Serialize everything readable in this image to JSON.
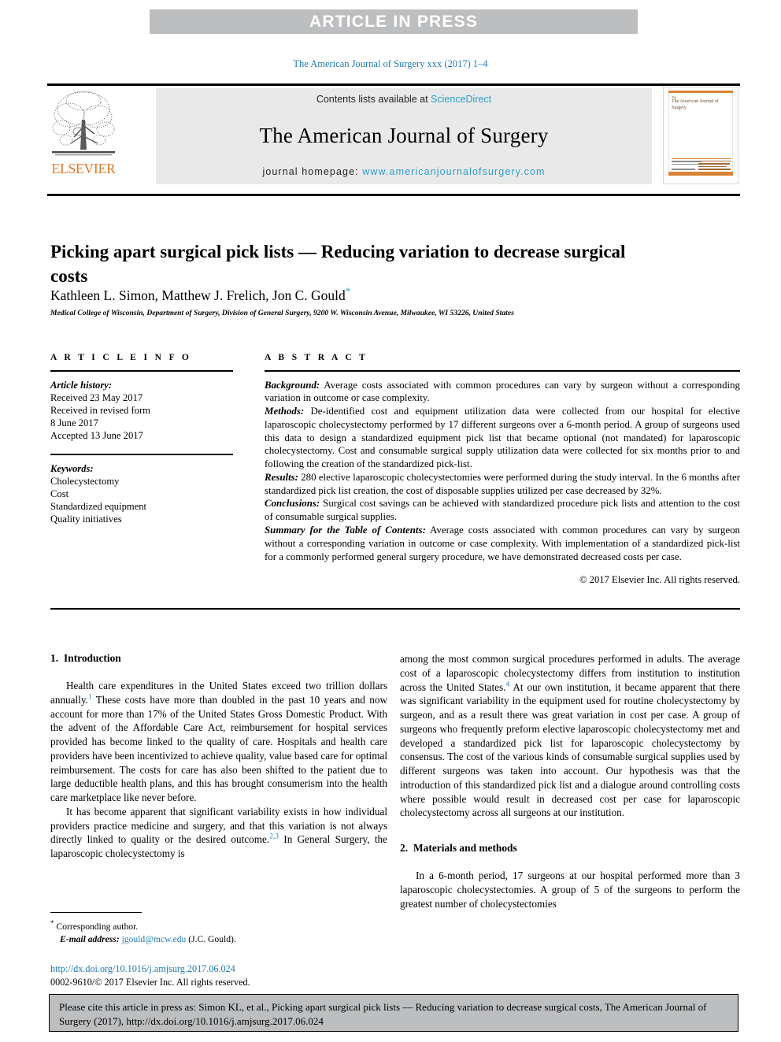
{
  "banner": {
    "text": "ARTICLE IN PRESS"
  },
  "running_head": {
    "text": "The American Journal of Surgery xxx (2017) 1–4"
  },
  "masthead": {
    "publisher_name": "ELSEVIER",
    "contents_prefix": "Contents lists available at ",
    "contents_link": "ScienceDirect",
    "journal_title": "The American Journal of Surgery",
    "homepage_label": "journal homepage: ",
    "homepage_url": "www.americanjournalofsurgery.com",
    "cover_title": "The American Journal of Surgery",
    "accent_orange": "#E87722",
    "link_blue": "#2b9ccc"
  },
  "article": {
    "title": "Picking apart surgical pick lists — Reducing variation to decrease surgical costs",
    "authors": "Kathleen L. Simon, Matthew J. Frelich, Jon C. Gould",
    "corresponding_marker": "*",
    "affiliation": "Medical College of Wisconsin, Department of Surgery, Division of General Surgery, 9200 W. Wisconsin Avenue, Milwaukee, WI 53226, United States"
  },
  "article_info": {
    "heading": "A R T I C L E  I N F O",
    "history_label": "Article history:",
    "history_lines": [
      "Received 23 May 2017",
      "Received in revised form",
      "8 June 2017",
      "Accepted 13 June 2017"
    ],
    "keywords_label": "Keywords:",
    "keywords": [
      "Cholecystectomy",
      "Cost",
      "Standardized equipment",
      "Quality initiatives"
    ]
  },
  "abstract": {
    "heading": "A B S T R A C T",
    "sections": [
      {
        "label": "Background:",
        "text": " Average costs associated with common procedures can vary by surgeon without a corresponding variation in outcome or case complexity."
      },
      {
        "label": "Methods:",
        "text": " De-identified cost and equipment utilization data were collected from our hospital for elective laparoscopic cholecystectomy performed by 17 different surgeons over a 6-month period. A group of surgeons used this data to design a standardized equipment pick list that became optional (not mandated) for laparoscopic cholecystectomy. Cost and consumable surgical supply utilization data were collected for six months prior to and following the creation of the standardized pick-list."
      },
      {
        "label": "Results:",
        "text": " 280 elective laparoscopic cholecystectomies were performed during the study interval. In the 6 months after standardized pick list creation, the cost of disposable supplies utilized per case decreased by 32%."
      },
      {
        "label": "Conclusions:",
        "text": " Surgical cost savings can be achieved with standardized procedure pick lists and attention to the cost of consumable surgical supplies."
      },
      {
        "label": "Summary for the Table of Contents:",
        "text": " Average costs associated with common procedures can vary by surgeon without a corresponding variation in outcome or case complexity. With implementation of a standardized pick-list for a commonly performed general surgery procedure, we have demonstrated decreased costs per case."
      }
    ],
    "copyright": "© 2017 Elsevier Inc. All rights reserved."
  },
  "body": {
    "left_column": {
      "section_number": "1.",
      "section_title": "Introduction",
      "paragraph_1_a": "Health care expenditures in the United States exceed two trillion dollars annually.",
      "paragraph_1_ref": "1",
      "paragraph_1_b": " These costs have more than doubled in the past 10 years and now account for more than 17% of the United States Gross Domestic Product. With the advent of the Affordable Care Act, reimbursement for hospital services provided has become linked to the quality of care. Hospitals and health care providers have been incentivized to achieve quality, value based care for optimal reimbursement. The costs for care has also been shifted to the patient due to large deductible health plans, and this has brought consumerism into the health care marketplace like never before.",
      "paragraph_2_a": "It has become apparent that significant variability exists in how individual providers practice medicine and surgery, and that this variation is not always directly linked to quality or the desired outcome.",
      "paragraph_2_ref": "2,3",
      "paragraph_2_b": " In General Surgery, the laparoscopic cholecystectomy is"
    },
    "right_column": {
      "paragraph_1_a": "among the most common surgical procedures performed in adults. The average cost of a laparoscopic cholecystectomy differs from institution to institution across the United States.",
      "paragraph_1_ref": "4",
      "paragraph_1_b": " At our own institution, it became apparent that there was significant variability in the equipment used for routine cholecystectomy by surgeon, and as a result there was great variation in cost per case. A group of surgeons who frequently preform elective laparoscopic cholecystectomy met and developed a standardized pick list for laparoscopic cholecystectomy by consensus. The cost of the various kinds of consumable surgical supplies used by different surgeons was taken into account. Our hypothesis was that the introduction of this standardized pick list and a dialogue around controlling costs where possible would result in decreased cost per case for laparoscopic cholecystectomy across all surgeons at our institution.",
      "section_number": "2.",
      "section_title": "Materials and methods",
      "paragraph_2": "In a 6-month period, 17 surgeons at our hospital performed more than 3 laparoscopic cholecystectomies. A group of 5 of the surgeons to perform the greatest number of cholecystectomies"
    }
  },
  "footnote": {
    "star": "*",
    "corresponding": "Corresponding author.",
    "email_label": "E-mail address:",
    "email": "jgould@mcw.edu",
    "email_attrib": "(J.C. Gould).",
    "doi_url": "http://dx.doi.org/10.1016/j.amjsurg.2017.06.024",
    "issn_line": "0002-9610/© 2017 Elsevier Inc. All rights reserved."
  },
  "citation_footer": {
    "text": "Please cite this article in press as: Simon KL, et al., Picking apart surgical pick lists — Reducing variation to decrease surgical costs, The American Journal of Surgery (2017), http://dx.doi.org/10.1016/j.amjsurg.2017.06.024"
  }
}
